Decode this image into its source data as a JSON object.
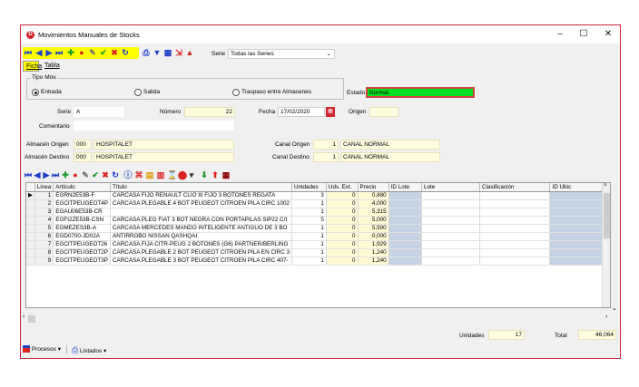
{
  "window": {
    "title": "Movimientos Manuales de Stocks",
    "app_icon": "D"
  },
  "toolbar": {
    "serie_label": "Serie",
    "serie_value": "Todas las Series"
  },
  "tabs": [
    {
      "label": "Ficha"
    },
    {
      "label": "Tabla"
    }
  ],
  "tipo_mov": {
    "label": "Tipo Mov.",
    "options": [
      {
        "label": "Entrada",
        "selected": true
      },
      {
        "label": "Salida",
        "selected": false
      },
      {
        "label": "Traspaso entre Almacenes",
        "selected": false
      }
    ]
  },
  "form": {
    "estado_label": "Estado",
    "estado_value": "Normal",
    "serie_label": "Serie",
    "serie_value": "A",
    "numero_label": "Número",
    "numero_value": "22",
    "fecha_label": "Fecha",
    "fecha_value": "17/02/2020",
    "origen_label": "Origen",
    "origen_value": "",
    "comentario_label": "Comentario",
    "comentario_value": "",
    "almacen_origen_label": "Almacén Origen",
    "almacen_origen_code": "000",
    "almacen_origen_name": "HOSPITALET",
    "canal_origen_label": "Canal Origen",
    "canal_origen_code": "1",
    "canal_origen_name": "CANAL NORMAL",
    "almacen_destino_label": "Almacén Destino",
    "almacen_destino_code": "000",
    "almacen_destino_name": "HOSPITALET",
    "canal_destino_label": "Canal Destino",
    "canal_destino_code": "1",
    "canal_destino_name": "CANAL NORMAL"
  },
  "grid": {
    "columns": [
      "Linea",
      "Artículo",
      "Título",
      "Unidades",
      "Uds. Ext.",
      "Precio",
      "ID Lote",
      "Lote",
      "Clasificación",
      "ID Ubic"
    ],
    "rows": [
      [
        "1",
        "EGRN2E53B-F",
        "CARCASA FIJO RENAULT CLIO III FIJO 3 BOTONES REGATA",
        "3",
        "0",
        "0,880",
        "",
        "",
        "",
        ""
      ],
      [
        "2",
        "EGCITPEUGEOT4P",
        "CARCASA PLEGABLE 4 BOT PEUGEOT CITROEN PILA CIRC 1002",
        "1",
        "0",
        "4,000",
        "",
        "",
        "",
        ""
      ],
      [
        "3",
        "EGAU06E53B-CR",
        "",
        "1",
        "0",
        "5,315",
        "",
        "",
        "",
        ""
      ],
      [
        "4",
        "EGFI2ZE53B-CSN",
        "CARCASA PLEG FIAT 3 BOT NEGRA CON PORTAPILAS SIP22 C/I",
        "5",
        "0",
        "5,000",
        "",
        "",
        "",
        ""
      ],
      [
        "5",
        "EGMEZES3B-A",
        "CARCASA MERCEDES MANDO INTELIGENTE ANTIGUO DE 3 BO",
        "1",
        "0",
        "5,500",
        "",
        "",
        "",
        ""
      ],
      [
        "6",
        "EGD0700-JD02A",
        "ANTIRROBO NISSAN QASHQAI",
        "1",
        "0",
        "0,000",
        "",
        "",
        "",
        ""
      ],
      [
        "7",
        "EGCITPEUGEOT26",
        "CARCASA FIJA CITR-PEUG 2 BOTONES (G6) PARTNER/BERLING",
        "1",
        "0",
        "1,929",
        "",
        "",
        "",
        ""
      ],
      [
        "8",
        "EGCITPEUGEOT2P",
        "CARCASA PLEGABLE 2 BOT PEUGEOT CITROEN PILA EN CIRC 3",
        "1",
        "0",
        "1,240",
        "",
        "",
        "",
        ""
      ],
      [
        "9",
        "EGCITPEUGEOT3P",
        "CARCASA PLEGABLE 3 BOT PEUGEOT CITROEN PILA CIRC 407-",
        "1",
        "0",
        "1,240",
        "",
        "",
        "",
        ""
      ]
    ]
  },
  "totals": {
    "unidades_label": "Unidades",
    "unidades_value": "17",
    "total_label": "Total",
    "total_value": "46,064"
  },
  "footer": {
    "procesos_label": "Procesos",
    "listados_label": "Listados"
  },
  "colors": {
    "accent": "#c8233a",
    "estado_fill": "#00e020",
    "highlight": "#ffff00"
  }
}
